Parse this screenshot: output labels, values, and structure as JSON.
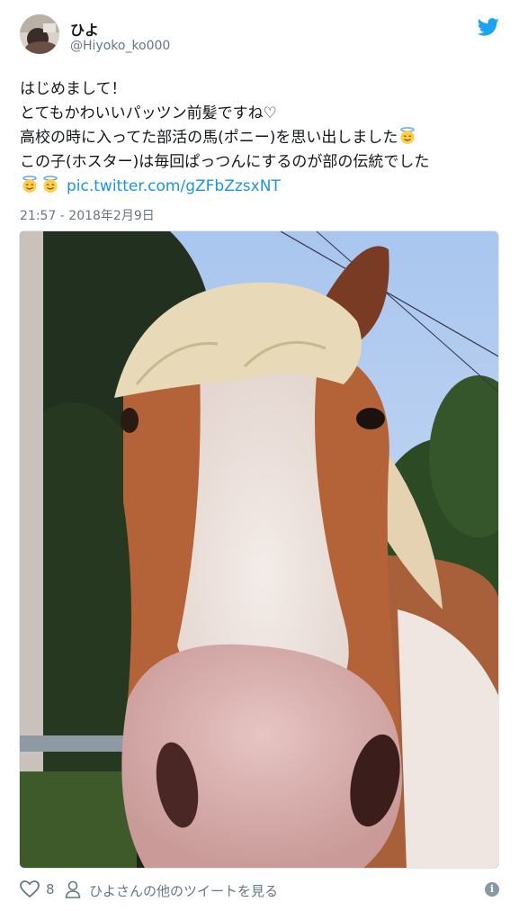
{
  "tweet": {
    "user": {
      "name": "ひよ",
      "handle": "@Hiyoko_ko000"
    },
    "text_lines": [
      "はじめまして！",
      "とてもかわいいパッツン前髪ですね♡",
      "高校の時に入ってた部活の馬(ポニー)を思い出しました",
      "この子(ホスター)は毎回ぱっつんにするのが部の伝統でした",
      ""
    ],
    "link_text": "pic.twitter.com/gZFbZzsxNT",
    "timestamp": "21:57 - 2018年2月9日",
    "likes": "8",
    "more_tweets": "ひよさんの他のツイートを見る",
    "info_glyph": "i",
    "icons": {
      "brand": "twitter-bird-icon",
      "like": "heart-icon",
      "profile": "person-icon",
      "info": "info-icon",
      "emoji": "smiling-face-with-halo-emoji"
    },
    "colors": {
      "link": "#1b95e0",
      "twitter_blue": "#1da1f2",
      "secondary_text": "#657786"
    }
  }
}
